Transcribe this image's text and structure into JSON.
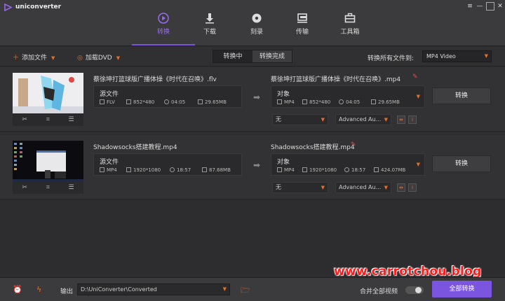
{
  "app": {
    "name": "uniconverter"
  },
  "nav": [
    {
      "label": "转换",
      "icon": "convert-icon",
      "active": true
    },
    {
      "label": "下载",
      "icon": "download-icon"
    },
    {
      "label": "刻录",
      "icon": "burn-icon"
    },
    {
      "label": "传输",
      "icon": "transfer-icon"
    },
    {
      "label": "工具箱",
      "icon": "toolbox-icon"
    }
  ],
  "toolbar": {
    "add_files": "添加文件",
    "load_dvd": "加载DVD",
    "tab_converting": "转换中",
    "tab_converted": "转换完成",
    "convert_all_to_label": "转换所有文件到:",
    "convert_all_to_value": "MP4 Video"
  },
  "files": [
    {
      "source": {
        "name": "蔡徐坤打篮球版广播体操《时代在召唤》.flv",
        "label": "源文件",
        "format": "FLV",
        "resolution": "852*480",
        "duration": "04:05",
        "size": "29.65MB"
      },
      "target": {
        "name": "蔡徐坤打篮球版广播体操《时代在召唤》.mp4",
        "label": "对象",
        "format": "MP4",
        "resolution": "852*480",
        "duration": "04:05",
        "size": "29.65MB"
      },
      "subtitle": "无",
      "audio": "Advanced Au...",
      "convert_label": "转换"
    },
    {
      "source": {
        "name": "Shadowsocks搭建教程.mp4",
        "label": "源文件",
        "format": "MP4",
        "resolution": "1920*1080",
        "duration": "18:57",
        "size": "87.68MB"
      },
      "target": {
        "name": "Shadowsocks搭建教程.mp4",
        "label": "对象",
        "format": "MP4",
        "resolution": "1920*1080",
        "duration": "18:57",
        "size": "424.07MB"
      },
      "subtitle": "无",
      "audio": "Advanced Au...",
      "convert_label": "转换"
    }
  ],
  "bottom": {
    "output_label": "输出",
    "output_path": "D:\\UniConverter\\Converted",
    "merge_label": "合并全部视频",
    "merge_on": false,
    "convert_all": "全部转换"
  },
  "watermark": "www.carrotchou.blog",
  "colors": {
    "accent": "#7b55e0",
    "orange": "#e0702a",
    "watermark": "#ff1a1a"
  }
}
